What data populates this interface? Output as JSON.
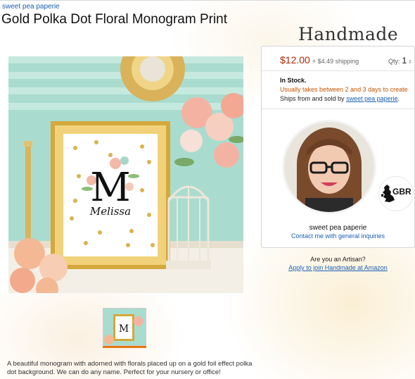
{
  "breadcrumb": {
    "seller_link": "sweet pea paperie"
  },
  "product": {
    "title": "Gold Polka Dot Floral Monogram Print",
    "image_alt": "Framed gold polka dot floral monogram print with letter M and the name Melissa",
    "print_letter": "M",
    "print_name": "Melissa",
    "description": "A beautiful monogram with adorned with florals placed up on a gold foil effect polka dot background. We can do any name. Perfect for your nursery or office!"
  },
  "brand": {
    "logo_text": "Handmade"
  },
  "buy_box": {
    "price": "$12.00",
    "shipping": "+ $4.49 shipping",
    "qty_label": "Qty:",
    "qty_value": "1",
    "qty_arrows": "⇕",
    "stock": "In Stock.",
    "delivery_note": "Usually takes between 2 and 3 days to create",
    "ships_from_prefix": "Ships from and sold by ",
    "ships_from_seller": "sweet pea paperie",
    "ships_from_suffix": "."
  },
  "seller": {
    "name": "sweet pea paperie",
    "contact_link": "Contact me with general inquiries",
    "country_code": "GBR"
  },
  "artisan": {
    "question": "Are you an Artisan?",
    "apply_link": "Apply to join Handmade at Amazon"
  },
  "colors": {
    "link": "#1a5fb4",
    "price": "#b12704",
    "delivery": "#c45500",
    "selected_thumb": "#e47911"
  }
}
